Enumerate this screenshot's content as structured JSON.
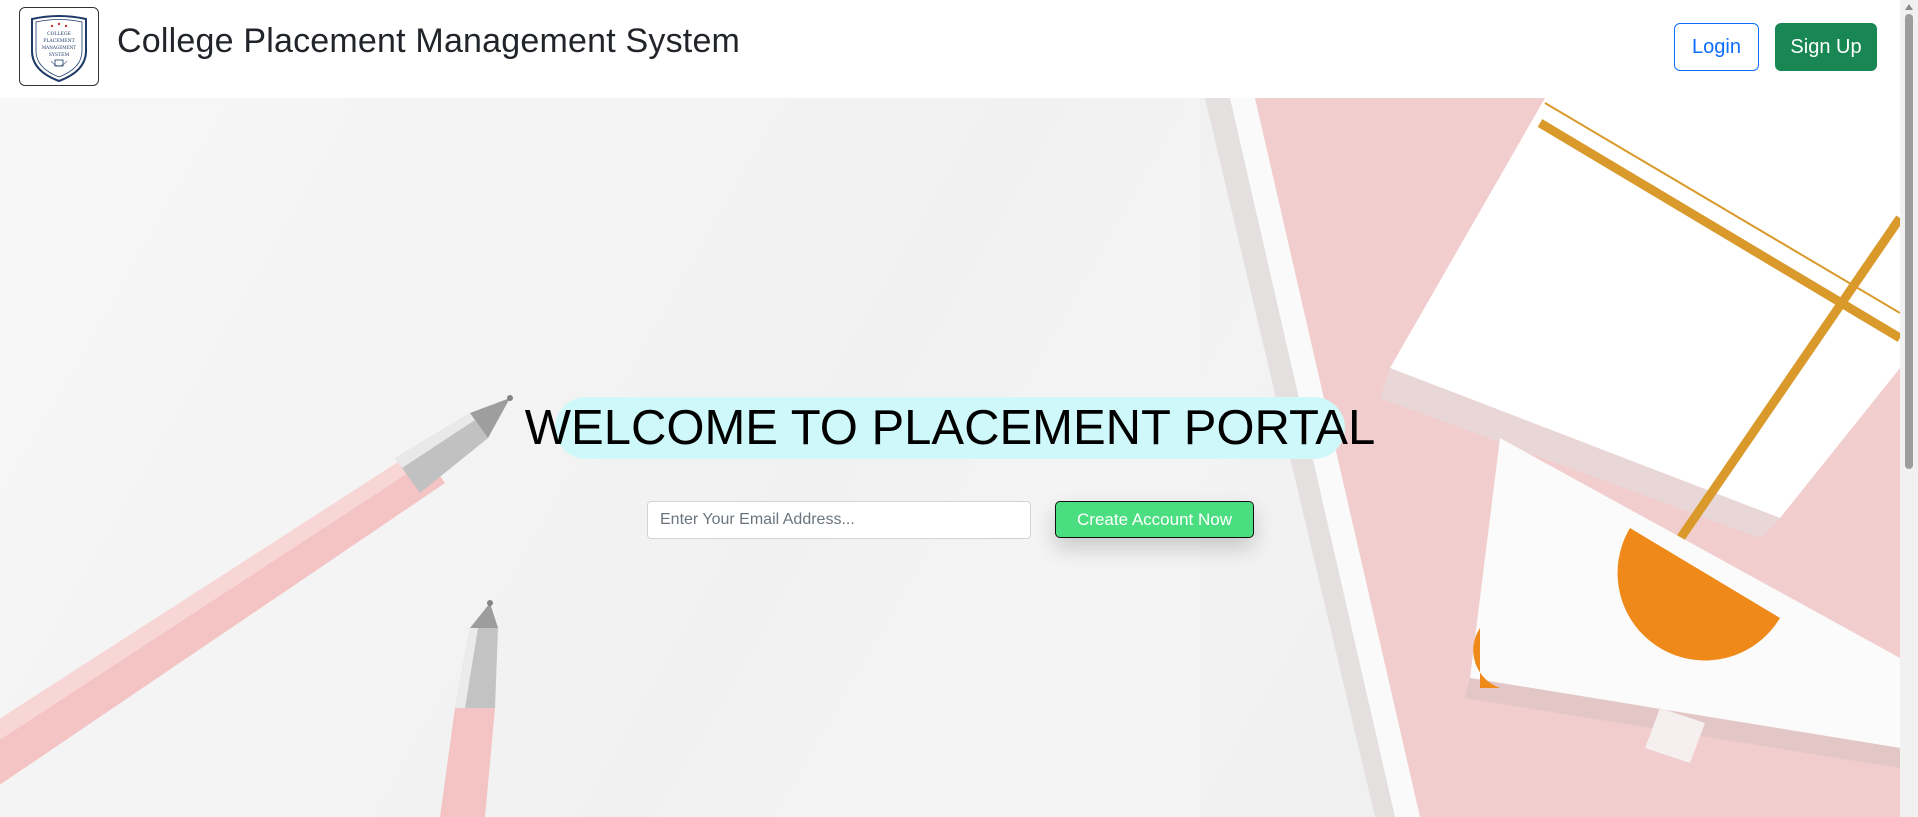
{
  "header": {
    "logo_lines": [
      "COLLEGE",
      "PLACEMENT",
      "MANAGEMENT",
      "SYSTEM"
    ],
    "title": "College Placement Management System",
    "login_label": "Login",
    "signup_label": "Sign Up"
  },
  "hero": {
    "heading": "WELCOME TO PLACEMENT PORTAL",
    "email_placeholder": "Enter Your Email Address...",
    "email_value": "",
    "create_button_label": "Create Account Now"
  },
  "colors": {
    "login_border": "#0d6efd",
    "signup_bg": "#198754",
    "create_button_bg": "#4ade80",
    "heading_highlight": "#cff8fb"
  },
  "icons": {
    "logo": "college-crest-logo-icon",
    "scroll_up": "scroll-up-arrow-icon"
  }
}
